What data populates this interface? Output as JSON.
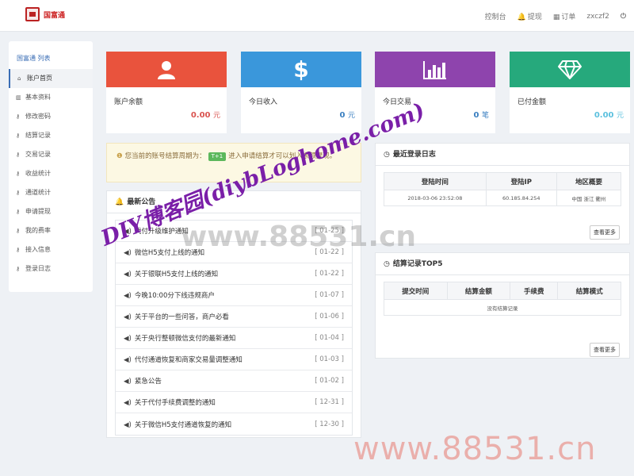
{
  "brand": {
    "name": "国富通"
  },
  "topnav": {
    "console": "控制台",
    "withdraw": "提现",
    "orders": "订单",
    "user": "zxczf2",
    "logout_icon": "power-icon"
  },
  "sidebar": {
    "title": "国富通 列表",
    "items": [
      {
        "label": "账户首页",
        "icon": "home-icon"
      },
      {
        "label": "基本资料",
        "icon": "bar-chart-icon"
      },
      {
        "label": "修改密码",
        "icon": "key-icon"
      },
      {
        "label": "结算记录",
        "icon": "key-icon"
      },
      {
        "label": "交易记录",
        "icon": "key-icon"
      },
      {
        "label": "收益统计",
        "icon": "key-icon"
      },
      {
        "label": "通道统计",
        "icon": "key-icon"
      },
      {
        "label": "申请提现",
        "icon": "key-icon"
      },
      {
        "label": "我的费率",
        "icon": "key-icon"
      },
      {
        "label": "接入信息",
        "icon": "key-icon"
      },
      {
        "label": "登录日志",
        "icon": "key-icon"
      }
    ]
  },
  "tiles": [
    {
      "label": "账户余额",
      "value": "0.00",
      "unit": "元",
      "color": "#e9533d",
      "value_color": "#d9534f",
      "icon": "user-icon"
    },
    {
      "label": "今日收入",
      "value": "0",
      "unit": "元",
      "color": "#3a97db",
      "value_color": "#3a7fc1",
      "icon": "dollar-icon"
    },
    {
      "label": "今日交易",
      "value": "0",
      "unit": "笔",
      "color": "#8e44ad",
      "value_color": "#3a7fc1",
      "icon": "bar-chart-icon"
    },
    {
      "label": "已付金额",
      "value": "0.00",
      "unit": "元",
      "color": "#26a97c",
      "value_color": "#5bc0de",
      "icon": "diamond-icon"
    }
  ],
  "notice": {
    "before": "您当前的账号结算周期为：",
    "badge": "T+1",
    "after": "进入申请结算才可以划入余额提现。"
  },
  "announcements": {
    "title": "最新公告",
    "items": [
      {
        "text": "代付升级维护通知",
        "date": "[ 01-25 ]"
      },
      {
        "text": "微信H5支付上线的通知",
        "date": "[ 01-22 ]"
      },
      {
        "text": "关于银联H5支付上线的通知",
        "date": "[ 01-22 ]"
      },
      {
        "text": "今晚10:00分下线违规商户",
        "date": "[ 01-07 ]"
      },
      {
        "text": "关于平台的一些问答，商户必看",
        "date": "[ 01-06 ]"
      },
      {
        "text": "关于央行整顿微信支付的最新通知",
        "date": "[ 01-04 ]"
      },
      {
        "text": "代付通道恢复和商家交易量调整通知",
        "date": "[ 01-03 ]"
      },
      {
        "text": "紧急公告",
        "date": "[ 01-02 ]"
      },
      {
        "text": "关于代付手续费调整的通知",
        "date": "[ 12-31 ]"
      },
      {
        "text": "关于微信H5支付通道恢复的通知",
        "date": "[ 12-30 ]"
      }
    ]
  },
  "login_log": {
    "title": "最近登录日志",
    "columns": [
      "登陆时间",
      "登陆IP",
      "地区概要"
    ],
    "rows": [
      [
        "2018-03-06 23:52:08",
        "60.185.84.254",
        "中国 浙江 衢州"
      ]
    ],
    "more": "查看更多"
  },
  "settlement": {
    "title": "结算记录TOP5",
    "columns": [
      "提交时间",
      "结算金额",
      "手续费",
      "结算模式"
    ],
    "empty": "没有结算记录",
    "more": "查看更多"
  },
  "watermarks": {
    "site": "www.88531.cn",
    "blog": "DIY博客园(diybLoghome.com)",
    "footer": "www.88531.cn"
  }
}
